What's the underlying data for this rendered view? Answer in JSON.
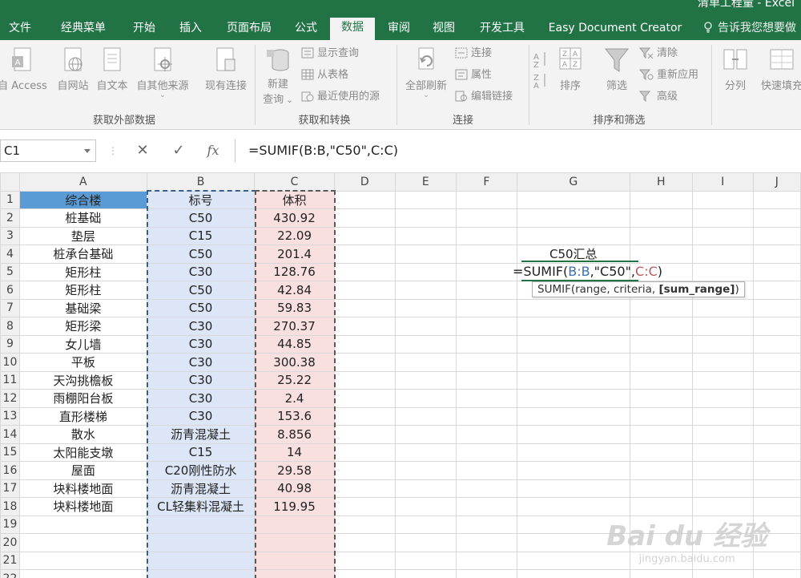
{
  "window": {
    "title": "清单工程量 - Excel"
  },
  "tabs": [
    "文件",
    "经典菜单",
    "开始",
    "插入",
    "页面布局",
    "公式",
    "数据",
    "审阅",
    "视图",
    "开发工具",
    "Easy Document Creator"
  ],
  "active_tab": "数据",
  "tell_me": "告诉我您想要做",
  "ribbon": {
    "get_external": {
      "label": "获取外部数据",
      "buttons": [
        "自 Access",
        "自网站",
        "自文本",
        "自其他来源",
        "现有连接"
      ]
    },
    "get_transform": {
      "label": "获取和转换",
      "new_query": [
        "新建",
        "查询"
      ],
      "small": [
        "显示查询",
        "从表格",
        "最近使用的源"
      ]
    },
    "connections": {
      "label": "连接",
      "refresh_all": "全部刷新",
      "small": [
        "连接",
        "属性",
        "编辑链接"
      ]
    },
    "sort_filter": {
      "label": "排序和筛选",
      "sort": "排序",
      "filter": "筛选",
      "small": [
        "清除",
        "重新应用",
        "高级"
      ]
    },
    "data_tools": {
      "split": "分列",
      "flash_fill": "快速填充"
    }
  },
  "formula_bar": {
    "name_box": "C1",
    "cancel": "✕",
    "enter": "✓",
    "fx": "fx",
    "formula": "=SUMIF(B:B,\"C50\",C:C)"
  },
  "columns": [
    "A",
    "B",
    "C",
    "D",
    "E",
    "F",
    "G",
    "H",
    "I",
    "J"
  ],
  "rows": [
    "1",
    "2",
    "3",
    "4",
    "5",
    "6",
    "7",
    "8",
    "9",
    "10",
    "11",
    "12",
    "13",
    "14",
    "15",
    "16",
    "17",
    "18",
    "19",
    "20",
    "21",
    "22"
  ],
  "table": {
    "headers": [
      "综合楼",
      "标号",
      "体积"
    ],
    "data": [
      [
        "桩基础",
        "C50",
        "430.92"
      ],
      [
        "垫层",
        "C15",
        "22.09"
      ],
      [
        "桩承台基础",
        "C50",
        "201.4"
      ],
      [
        "矩形柱",
        "C30",
        "128.76"
      ],
      [
        "矩形柱",
        "C50",
        "42.84"
      ],
      [
        "基础梁",
        "C50",
        "59.83"
      ],
      [
        "矩形梁",
        "C30",
        "270.37"
      ],
      [
        "女儿墙",
        "C30",
        "44.85"
      ],
      [
        "平板",
        "C30",
        "300.38"
      ],
      [
        "天沟挑檐板",
        "C30",
        "25.22"
      ],
      [
        "雨棚阳台板",
        "C30",
        "2.4"
      ],
      [
        "直形楼梯",
        "C30",
        "153.6"
      ],
      [
        "散水",
        "沥青混凝土",
        "8.856"
      ],
      [
        "太阳能支墩",
        "C15",
        "14"
      ],
      [
        "屋面",
        "C20刚性防水",
        "29.58"
      ],
      [
        "块料楼地面",
        "沥青混凝土",
        "40.98"
      ],
      [
        "块料楼地面",
        "CL轻集料混凝土",
        "119.95"
      ]
    ]
  },
  "g4_label": "C50汇总",
  "edit_cell": {
    "prefix": "=SUMIF(",
    "ref_b": "B:B",
    "middle": ",\"C50\",",
    "ref_c": "C:C",
    "suffix": ")"
  },
  "tooltip": {
    "text": "SUMIF(range, criteria, ",
    "bold": "[sum_range]",
    "end": ")"
  },
  "watermark": {
    "line1": "Bai du 经验",
    "line2": "jingyan.baidu.com"
  },
  "colors": {
    "excel_green": "#217346",
    "header_blue": "#5b9bd5",
    "col_b_fill": "#dce6f6",
    "col_c_fill": "#f9e0e0"
  }
}
